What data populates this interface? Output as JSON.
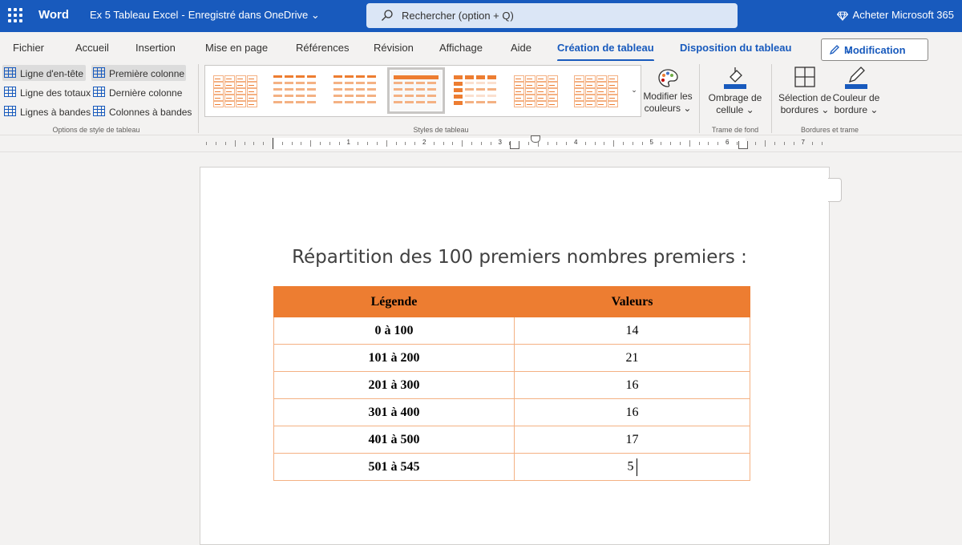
{
  "titlebar": {
    "app": "Word",
    "doc_name": "Ex 5 Tableau Excel",
    "separator": "-",
    "save_status": "Enregistré dans OneDrive",
    "search_placeholder": "Rechercher (option + Q)",
    "buy_label": "Acheter Microsoft 365"
  },
  "tabs": [
    "Fichier",
    "Accueil",
    "Insertion",
    "Mise en page",
    "Références",
    "Révision",
    "Affichage",
    "Aide",
    "Création de tableau",
    "Disposition du tableau"
  ],
  "active_tab": "Création de tableau",
  "mode_button": "Modification",
  "style_options": {
    "group_label": "Options de style de tableau",
    "items": [
      {
        "label": "Ligne d'en-tête",
        "checked": true
      },
      {
        "label": "Première colonne",
        "checked": true
      },
      {
        "label": "Ligne des totaux",
        "checked": false
      },
      {
        "label": "Dernière colonne",
        "checked": false
      },
      {
        "label": "Lignes à bandes",
        "checked": false
      },
      {
        "label": "Colonnes à bandes",
        "checked": false
      }
    ]
  },
  "table_styles": {
    "group_label": "Styles de tableau",
    "modify_colors_line1": "Modifier les",
    "modify_colors_line2": "couleurs ⌄",
    "accent_color": "#ed7d31"
  },
  "shading": {
    "group_label": "Trame de fond",
    "line1": "Ombrage de",
    "line2": "cellule ⌄"
  },
  "borders": {
    "group_label": "Bordures et trame",
    "select_line1": "Sélection de",
    "select_line2": "bordures ⌄",
    "color_line1": "Couleur de",
    "color_line2": "bordure ⌄"
  },
  "ruler_numbers": [
    "1",
    "2",
    "3",
    "4",
    "5",
    "6",
    "7"
  ],
  "document": {
    "heading": "Répartition des 100 premiers nombres premiers :",
    "table": {
      "headers": [
        "Légende",
        "Valeurs"
      ],
      "rows": [
        [
          "0 à 100",
          "14"
        ],
        [
          "101 à 200",
          "21"
        ],
        [
          "201 à 300",
          "16"
        ],
        [
          "301 à 400",
          "16"
        ],
        [
          "401 à 500",
          "17"
        ],
        [
          "501 à 545",
          "5"
        ]
      ]
    }
  }
}
